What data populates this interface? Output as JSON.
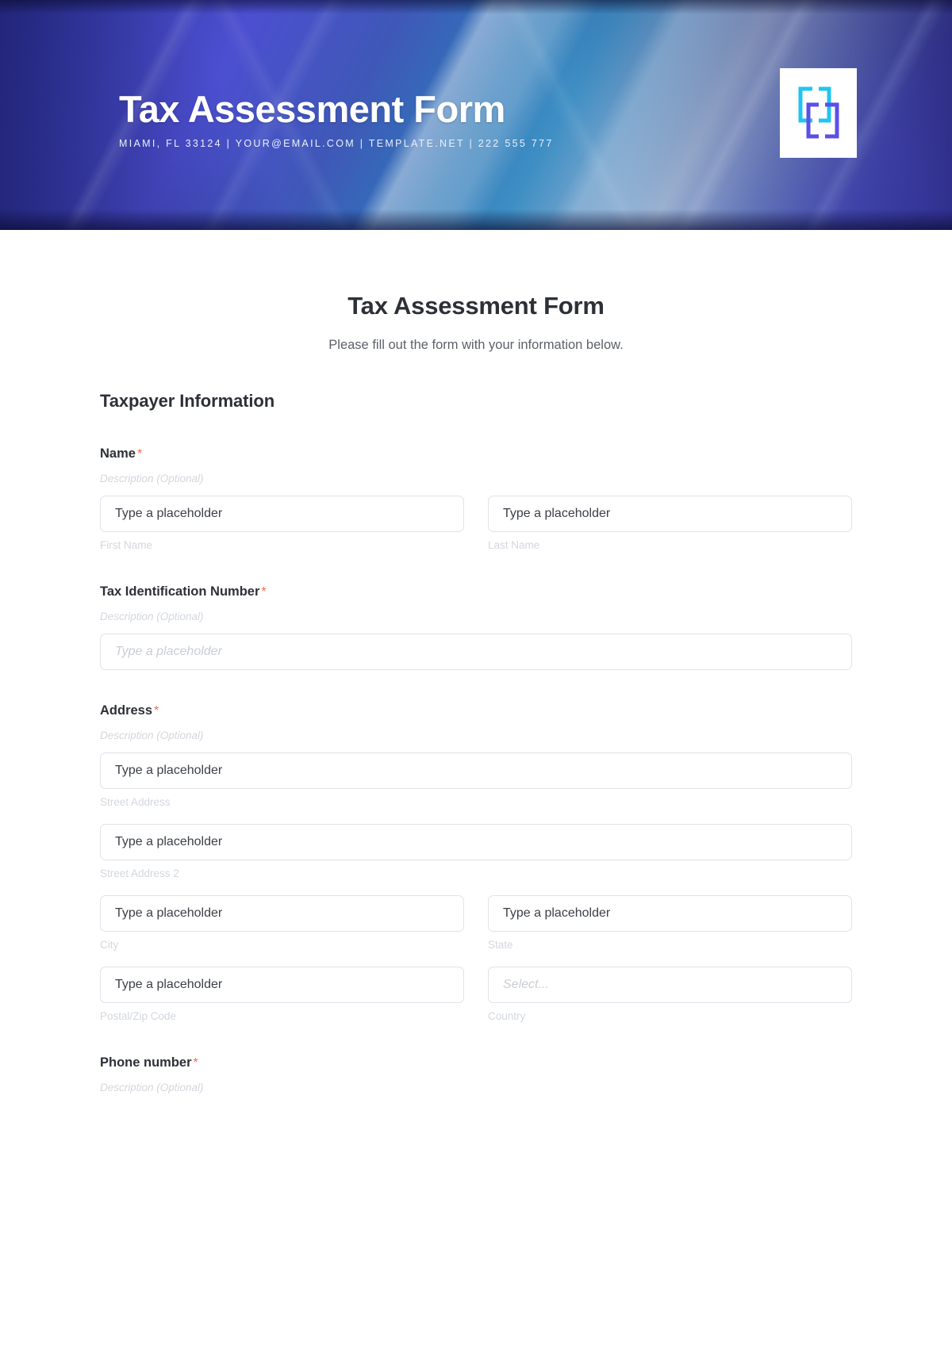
{
  "banner": {
    "title": "Tax Assessment Form",
    "contact": "MIAMI, FL 33124 | YOUR@EMAIL.COM | TEMPLATE.NET | 222 555 777",
    "logo_icon": "bracket-squares-logo-icon",
    "colors": {
      "gradient_start": "#2b2f8f",
      "gradient_mid": "#9fb6d4",
      "gradient_end": "#3a3fae",
      "logo_cyan": "#21c4f0",
      "logo_violet": "#5b4fe8"
    }
  },
  "form": {
    "title": "Tax Assessment Form",
    "subtitle": "Please fill out the form with your information below.",
    "required_marker": "*",
    "accent_required_color": "#f9694c",
    "section_heading": "Taxpayer Information",
    "fields": [
      {
        "label": "Name",
        "required": true,
        "description": "Description (Optional)",
        "inputs": [
          {
            "placeholder": "Type a placeholder",
            "sub_label": "First Name",
            "style": "solid"
          },
          {
            "placeholder": "Type a placeholder",
            "sub_label": "Last Name",
            "style": "solid"
          }
        ]
      },
      {
        "label": "Tax Identification Number",
        "required": true,
        "description": "Description (Optional)",
        "inputs": [
          {
            "placeholder": "Type a placeholder",
            "sub_label": "",
            "style": "ghost"
          }
        ]
      },
      {
        "label": "Address",
        "required": true,
        "description": "Description (Optional)",
        "inputs": [
          {
            "placeholder": "Type a placeholder",
            "sub_label": "Street Address",
            "style": "solid"
          },
          {
            "placeholder": "Type a placeholder",
            "sub_label": "Street Address 2",
            "style": "solid"
          },
          {
            "placeholder": "Type a placeholder",
            "sub_label": "City",
            "style": "solid"
          },
          {
            "placeholder": "Type a placeholder",
            "sub_label": "State",
            "style": "solid"
          },
          {
            "placeholder": "Type a placeholder",
            "sub_label": "Postal/Zip Code",
            "style": "solid"
          },
          {
            "placeholder": "Select...",
            "sub_label": "Country",
            "style": "ghost"
          }
        ]
      },
      {
        "label": "Phone number",
        "required": true,
        "description": "Description (Optional)",
        "inputs": []
      }
    ]
  }
}
